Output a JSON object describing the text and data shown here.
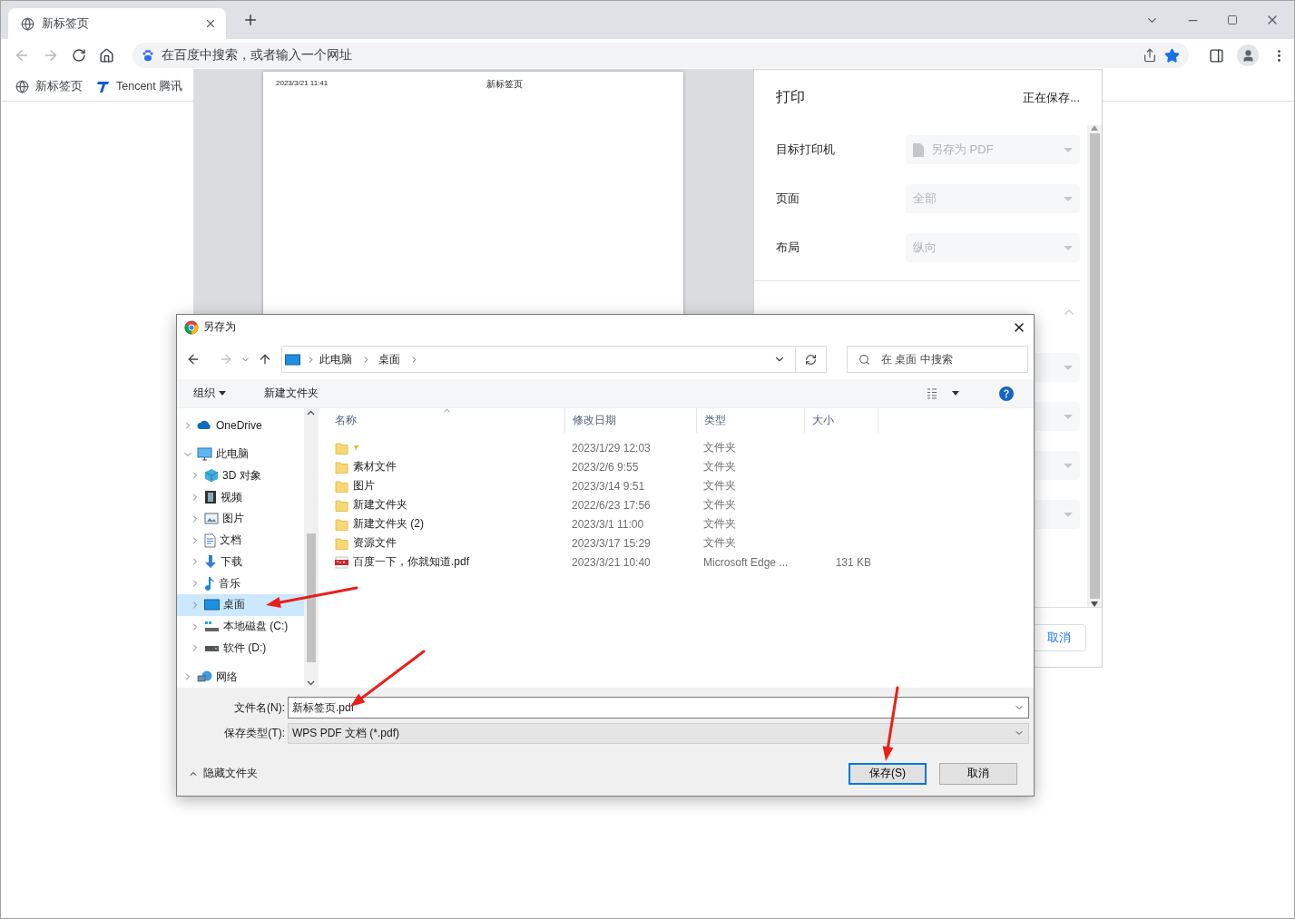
{
  "browser": {
    "tabs": [
      {
        "title": "新标签页",
        "selected": true
      }
    ],
    "address": {
      "placeholder": "在百度中搜索，或者输入一个网址"
    },
    "bookmarked": true,
    "bookmarks": [
      {
        "label": "新标签页",
        "kind": "globe"
      },
      {
        "label": "Tencent 腾讯",
        "kind": "tencent"
      }
    ]
  },
  "print_preview": {
    "page_header": {
      "date": "2023/3/21 11:41",
      "title": "新标签页"
    },
    "title": "打印",
    "status": "正在保存...",
    "settings": [
      {
        "label": "目标打印机",
        "value": "另存为 PDF",
        "kind": "file"
      },
      {
        "label": "页面",
        "value": "全部",
        "kind": "plain"
      },
      {
        "label": "布局",
        "value": "纵向",
        "kind": "plain"
      }
    ],
    "cancel_button": "取消"
  },
  "dialog": {
    "title": "另存为",
    "breadcrumb": [
      "此电脑",
      "桌面"
    ],
    "search": {
      "placeholder": "在 桌面 中搜索"
    },
    "toolbar": {
      "organize": "组织",
      "new_folder": "新建文件夹"
    },
    "nav": [
      {
        "label": "OneDrive",
        "kind": "cloud",
        "expanded": false,
        "selected": false
      },
      {
        "label": "此电脑",
        "kind": "pc",
        "expanded": true,
        "selected": false,
        "children": [
          {
            "label": "3D 对象",
            "kind": "cube",
            "expanded": false,
            "selected": false
          },
          {
            "label": "视频",
            "kind": "video",
            "expanded": false,
            "selected": false
          },
          {
            "label": "图片",
            "kind": "pictures",
            "expanded": false,
            "selected": false
          },
          {
            "label": "文档",
            "kind": "document",
            "expanded": false,
            "selected": false
          },
          {
            "label": "下载",
            "kind": "download",
            "expanded": false,
            "selected": false
          },
          {
            "label": "音乐",
            "kind": "music",
            "expanded": false,
            "selected": false
          },
          {
            "label": "桌面",
            "kind": "desktop",
            "expanded": false,
            "selected": true
          },
          {
            "label": "本地磁盘 (C:)",
            "kind": "system-drive",
            "expanded": false,
            "selected": false
          },
          {
            "label": "软件 (D:)",
            "kind": "drive",
            "expanded": false,
            "selected": false
          }
        ]
      },
      {
        "label": "网络",
        "kind": "network",
        "expanded": false,
        "selected": false
      }
    ],
    "columns": [
      "名称",
      "修改日期",
      "类型",
      "大小"
    ],
    "files": [
      {
        "kind": "folder",
        "date": "2023/1/29 12:03",
        "type": "文件夹"
      },
      {
        "kind": "folder",
        "name": "素材文件",
        "date": "2023/2/6 9:55",
        "type": "文件夹"
      },
      {
        "kind": "folder",
        "name": "图片",
        "date": "2023/3/14 9:51",
        "type": "文件夹"
      },
      {
        "kind": "folder",
        "name": "新建文件夹",
        "date": "2022/6/23 17:56",
        "type": "文件夹"
      },
      {
        "kind": "folder",
        "name": "新建文件夹 (2)",
        "date": "2023/3/1 11:00",
        "type": "文件夹"
      },
      {
        "kind": "folder",
        "name": "资源文件",
        "date": "2023/3/17 15:29",
        "type": "文件夹"
      },
      {
        "kind": "pdf",
        "name": "百度一下，你就知道.pdf",
        "date": "2023/3/21 10:40",
        "type": "Microsoft Edge ...",
        "size": "131 KB"
      }
    ],
    "filename": {
      "label": "文件名(N):",
      "value": "新标签页.pdf"
    },
    "filetype": {
      "label": "保存类型(T):",
      "value": "WPS PDF 文档 (*.pdf)"
    },
    "hide_folders": "隐藏文件夹",
    "buttons": [
      {
        "label": "保存(S)",
        "default": true
      },
      {
        "label": "取消",
        "default": false
      }
    ]
  }
}
